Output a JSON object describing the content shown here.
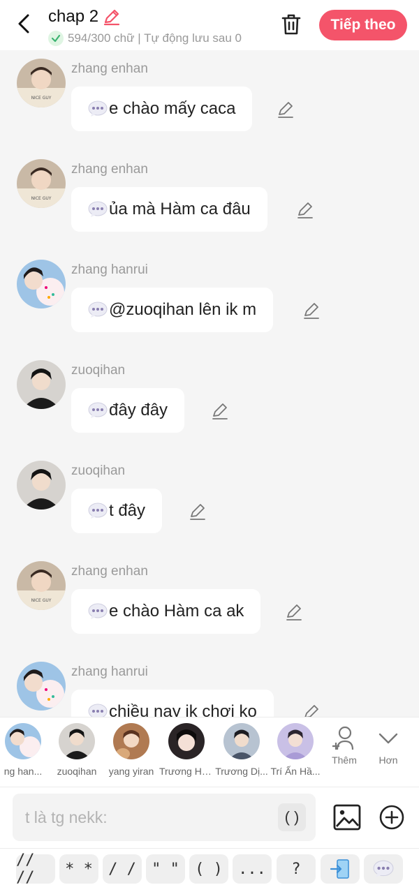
{
  "header": {
    "title": "chap 2",
    "status": "594/300 chữ | Tự động lưu sau 0",
    "next_label": "Tiếp theo"
  },
  "colors": {
    "accent": "#f4546a",
    "check": "#3cb371"
  },
  "messages": [
    {
      "sender": "zhang enhan",
      "text": "e chào mấy caca",
      "avatar": "enhan"
    },
    {
      "sender": "zhang enhan",
      "text": "ủa mà Hàm ca đâu",
      "avatar": "enhan"
    },
    {
      "sender": "zhang hanrui",
      "text": "@zuoqihan lên ik m",
      "avatar": "hanrui"
    },
    {
      "sender": "zuoqihan",
      "text": "đây đây",
      "avatar": "zuoqihan"
    },
    {
      "sender": "zuoqihan",
      "text": "t đây",
      "avatar": "zuoqihan"
    },
    {
      "sender": "zhang enhan",
      "text": "e chào Hàm ca ak",
      "avatar": "enhan"
    },
    {
      "sender": "zhang hanrui",
      "text": "chiều nay ik chơi ko",
      "avatar": "hanrui"
    }
  ],
  "characters": [
    {
      "name": "ng han...",
      "avatar": "hanrui"
    },
    {
      "name": "zuoqihan",
      "avatar": "zuoqihan"
    },
    {
      "name": "yang yiran",
      "avatar": "yiran"
    },
    {
      "name": "Trương Hà...",
      "avatar": "truongha"
    },
    {
      "name": "Trương Dị...",
      "avatar": "truongdi"
    },
    {
      "name": "Trí Ấn Hầ...",
      "avatar": "trian"
    }
  ],
  "utilities": {
    "add_label": "Thêm",
    "more_label": "Hơn"
  },
  "input": {
    "value": "t là tg nekk:",
    "paren": "( )"
  },
  "symbols": [
    "// //",
    "* *",
    "/ /",
    "\" \"",
    "( )",
    "...",
    "?"
  ],
  "icons": [
    "back-icon",
    "edit-pencil-icon",
    "check-icon",
    "trash-icon",
    "chat-bubble-icon",
    "add-person-icon",
    "chevron-down-icon",
    "image-icon",
    "plus-circle-icon",
    "exit-door-icon"
  ]
}
